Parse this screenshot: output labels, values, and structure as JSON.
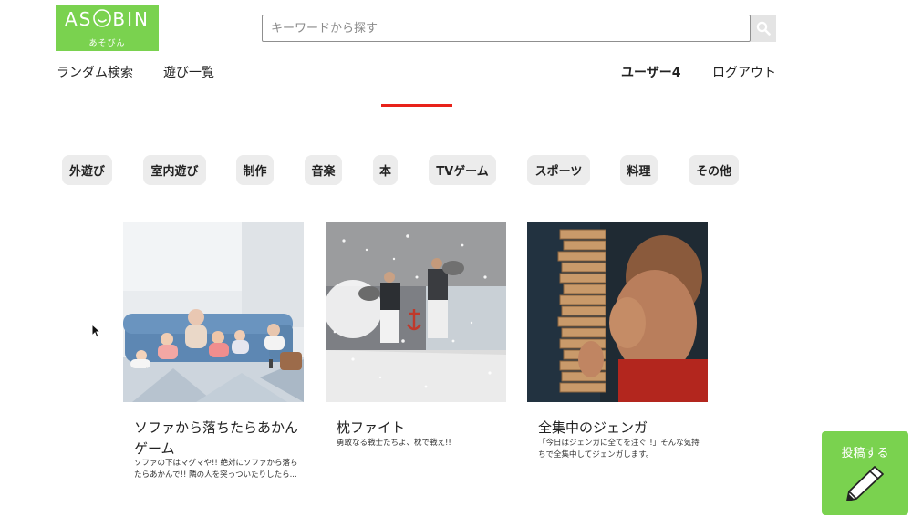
{
  "logo": {
    "text_left": "AS",
    "text_right": "BIN",
    "subtext": "あそびん"
  },
  "search": {
    "placeholder": "キーワードから探す"
  },
  "nav": {
    "random_search": "ランダム検索",
    "play_list": "遊び一覧",
    "user": "ユーザー4",
    "logout": "ログアウト"
  },
  "categories": [
    "外遊び",
    "室内遊び",
    "制作",
    "音楽",
    "本",
    "TVゲーム",
    "スポーツ",
    "料理",
    "その他"
  ],
  "cards": [
    {
      "title": "ソファから落ちたらあかんゲーム",
      "description": "ソファの下はマグマや!! 絶対にソファから落ちたらあかんで!! 隣の人を突っついたりしたら..."
    },
    {
      "title": "枕ファイト",
      "description": "勇敢なる戦士たちよ、枕で戦え!!"
    },
    {
      "title": "全集中のジェンガ",
      "description": "「今日はジェンガに全てを注ぐ!!」そんな気持ちで全集中してジェンガします。"
    }
  ],
  "post_button": {
    "label": "投稿する"
  },
  "colors": {
    "brand_green": "#7ad24f",
    "accent_red": "#e8221a",
    "chip_bg": "#ececec"
  },
  "icons": {
    "search": "magnifier-icon",
    "post": "pencil-icon",
    "logo": "smiley-icon"
  }
}
